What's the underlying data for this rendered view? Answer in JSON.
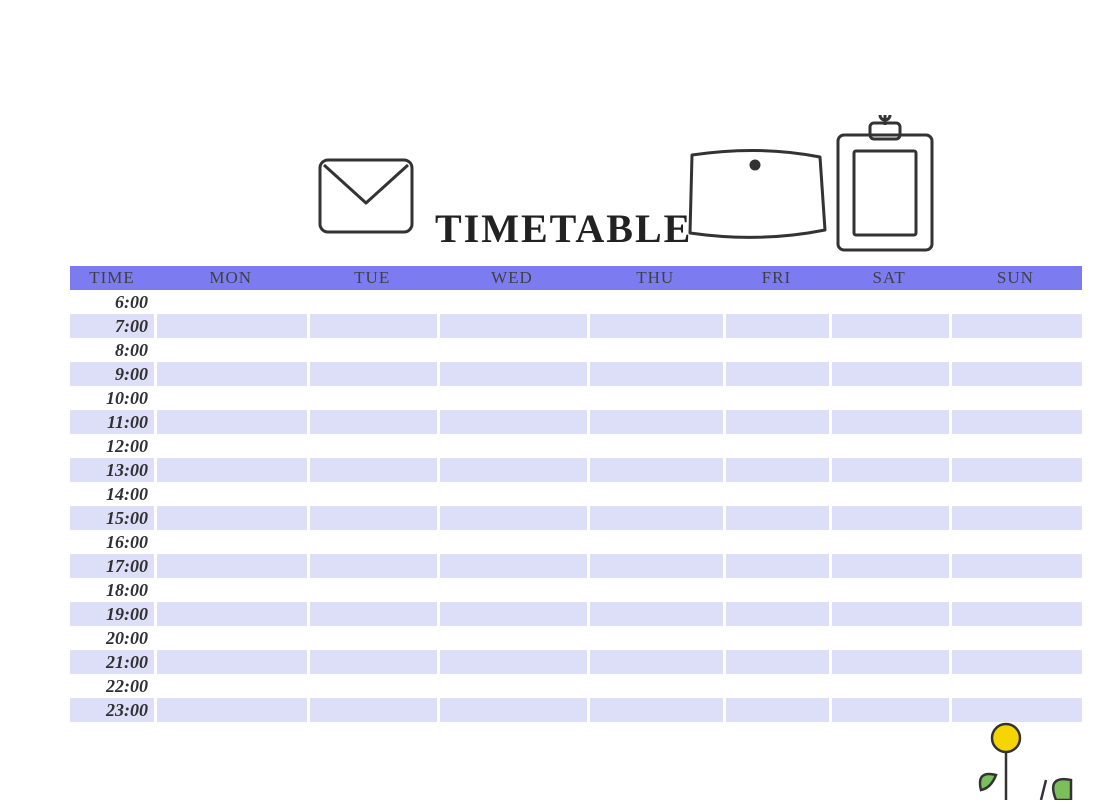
{
  "title": "TIMETABLE",
  "header": [
    "TIME",
    "MON",
    "TUE",
    "WED",
    "THU",
    "FRI",
    "SAT",
    "SUN"
  ],
  "rows": [
    {
      "time": "6:00",
      "cells": [
        "",
        "",
        "",
        "",
        "",
        "",
        ""
      ]
    },
    {
      "time": "7:00",
      "cells": [
        "",
        "",
        "",
        "",
        "",
        "",
        ""
      ]
    },
    {
      "time": "8:00",
      "cells": [
        "",
        "",
        "",
        "",
        "",
        "",
        ""
      ]
    },
    {
      "time": "9:00",
      "cells": [
        "",
        "",
        "",
        "",
        "",
        "",
        ""
      ]
    },
    {
      "time": "10:00",
      "cells": [
        "",
        "",
        "",
        "",
        "",
        "",
        ""
      ]
    },
    {
      "time": "11:00",
      "cells": [
        "",
        "",
        "",
        "",
        "",
        "",
        ""
      ]
    },
    {
      "time": "12:00",
      "cells": [
        "",
        "",
        "",
        "",
        "",
        "",
        ""
      ]
    },
    {
      "time": "13:00",
      "cells": [
        "",
        "",
        "",
        "",
        "",
        "",
        ""
      ]
    },
    {
      "time": "14:00",
      "cells": [
        "",
        "",
        "",
        "",
        "",
        "",
        ""
      ]
    },
    {
      "time": "15:00",
      "cells": [
        "",
        "",
        "",
        "",
        "",
        "",
        ""
      ]
    },
    {
      "time": "16:00",
      "cells": [
        "",
        "",
        "",
        "",
        "",
        "",
        ""
      ]
    },
    {
      "time": "17:00",
      "cells": [
        "",
        "",
        "",
        "",
        "",
        "",
        ""
      ]
    },
    {
      "time": "18:00",
      "cells": [
        "",
        "",
        "",
        "",
        "",
        "",
        ""
      ]
    },
    {
      "time": "19:00",
      "cells": [
        "",
        "",
        "",
        "",
        "",
        "",
        ""
      ]
    },
    {
      "time": "20:00",
      "cells": [
        "",
        "",
        "",
        "",
        "",
        "",
        ""
      ]
    },
    {
      "time": "21:00",
      "cells": [
        "",
        "",
        "",
        "",
        "",
        "",
        ""
      ]
    },
    {
      "time": "22:00",
      "cells": [
        "",
        "",
        "",
        "",
        "",
        "",
        ""
      ]
    },
    {
      "time": "23:00",
      "cells": [
        "",
        "",
        "",
        "",
        "",
        "",
        ""
      ]
    }
  ],
  "colors": {
    "header_bg": "#7c7cf0",
    "row_alt_bg": "#dddff8"
  }
}
